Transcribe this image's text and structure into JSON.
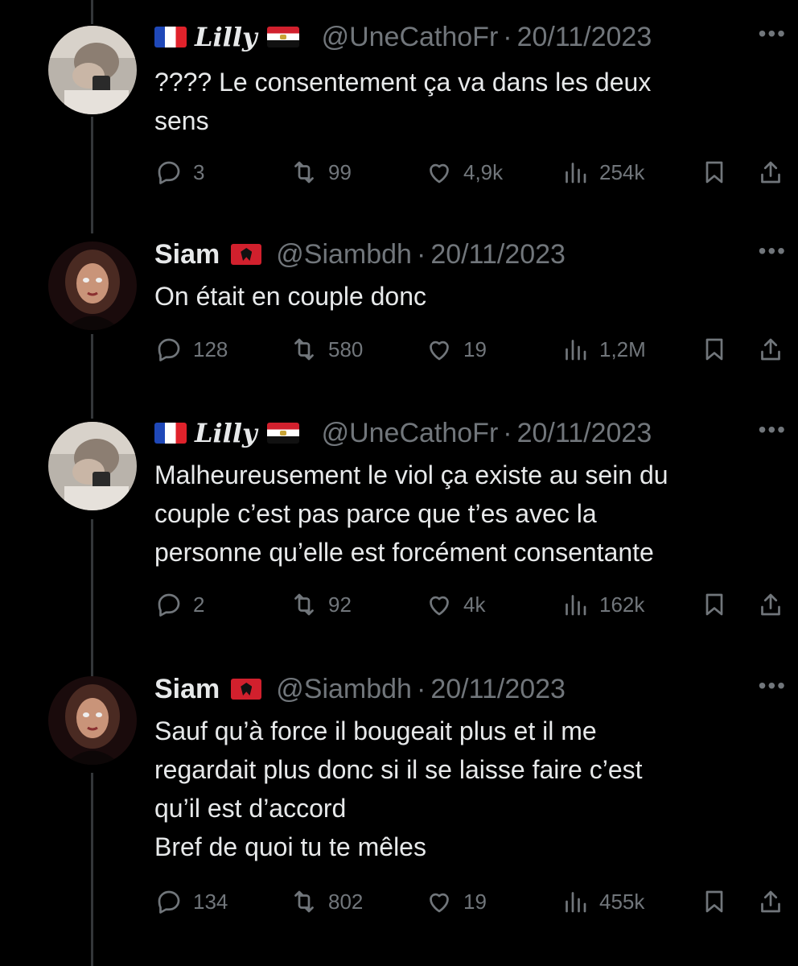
{
  "tweets": [
    {
      "author": "Lilly",
      "handle": "@UneCathoFr",
      "date": "20/11/2023",
      "lines": [
        "???? Le consentement ça va dans les deux",
        "sens"
      ],
      "replies": "3",
      "retweets": "99",
      "likes": "4,9k",
      "views": "254k"
    },
    {
      "author": "Siam",
      "handle": "@Siambdh",
      "date": "20/11/2023",
      "lines": [
        "On était en couple donc"
      ],
      "replies": "128",
      "retweets": "580",
      "likes": "19",
      "views": "1,2M"
    },
    {
      "author": "Lilly",
      "handle": "@UneCathoFr",
      "date": "20/11/2023",
      "lines": [
        "Malheureusement le viol ça existe au sein du",
        "couple c’est pas parce que t’es avec la",
        "personne qu’elle est forcément consentante"
      ],
      "replies": "2",
      "retweets": "92",
      "likes": "4k",
      "views": "162k"
    },
    {
      "author": "Siam",
      "handle": "@Siambdh",
      "date": "20/11/2023",
      "lines": [
        "Sauf qu’à force il bougeait plus et il me",
        "regardait plus donc si il se laisse faire c’est",
        "qu’il est d’accord",
        "Bref de quoi tu te mêles"
      ],
      "replies": "134",
      "retweets": "802",
      "likes": "19",
      "views": "455k"
    }
  ],
  "separator": "·",
  "more_label": "•••",
  "colors": {
    "background": "#000000",
    "text": "#e7e9ea",
    "muted": "#71767b",
    "thread_line": "#333639"
  },
  "icons": [
    "reply-icon",
    "retweet-icon",
    "like-icon",
    "views-icon",
    "bookmark-icon",
    "share-icon",
    "more-icon",
    "flag-france-icon",
    "flag-egypt-icon",
    "flag-albania-icon"
  ]
}
